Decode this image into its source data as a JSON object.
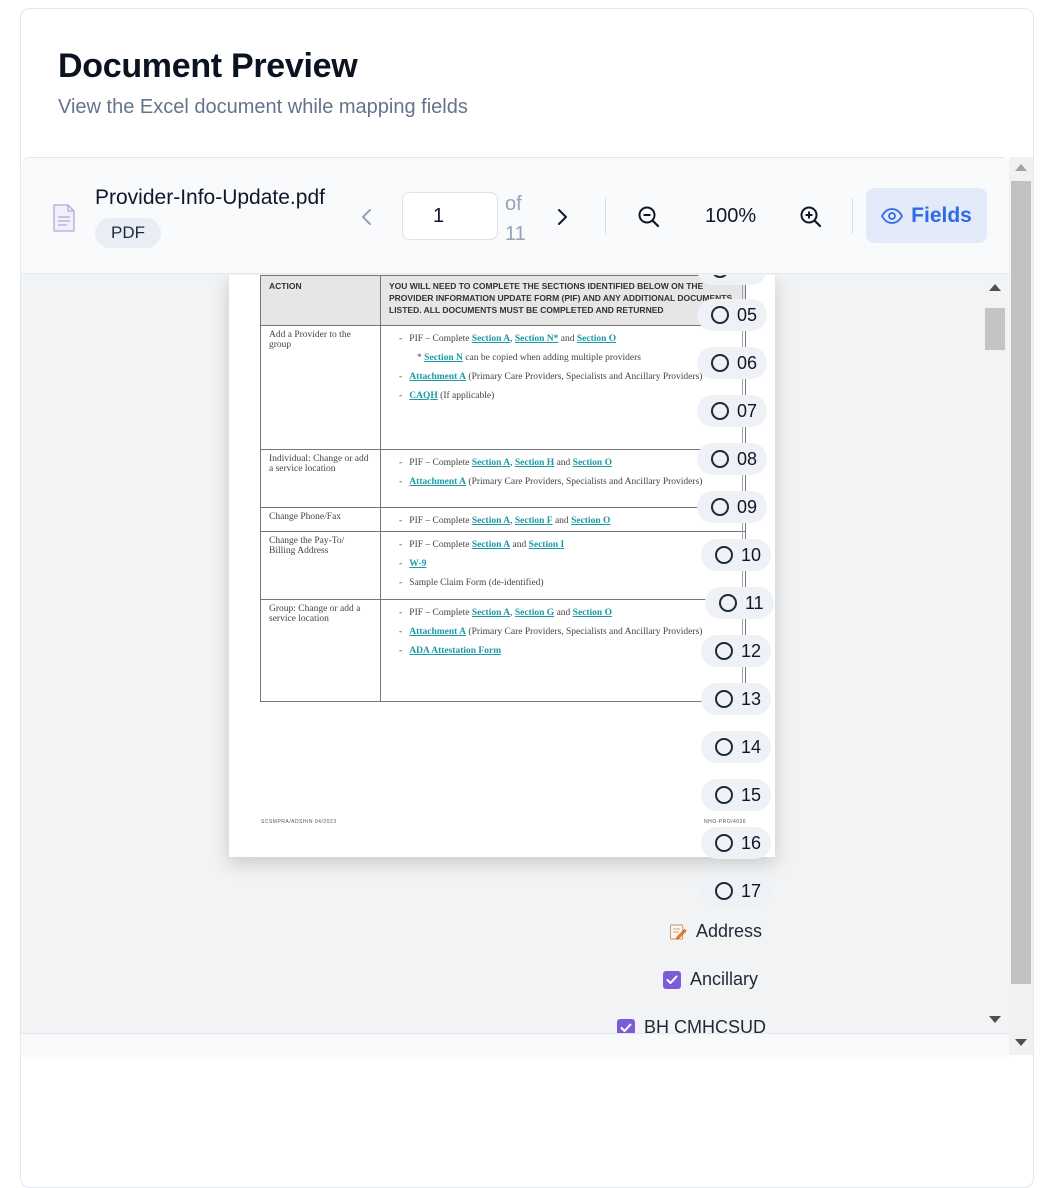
{
  "card": {
    "title": "Document Preview",
    "subtitle": "View the Excel document while mapping fields"
  },
  "toolbar": {
    "file_name": "Provider-Info-Update.pdf",
    "file_type": "PDF",
    "current_page": "1",
    "of_label": "of",
    "total_pages": "11",
    "zoom": "100%",
    "fields_label": "Fields"
  },
  "document": {
    "header_action": "ACTION",
    "header_desc": "YOU WILL NEED TO COMPLETE THE SECTIONS IDENTIFIED BELOW ON THE PROVIDER INFORMATION UPDATE FORM (PIF) AND ANY ADDITIONAL DOCUMENTS LISTED. ALL DOCUMENTS MUST BE COMPLETED AND RETURNED",
    "rows": [
      {
        "action": "Add a Provider to the group"
      },
      {
        "action": "Individual: Change or add a service location"
      },
      {
        "action": "Change Phone/Fax"
      },
      {
        "action": "Change the Pay-To/ Billing Address"
      },
      {
        "action": "Group: Change or add a service location"
      }
    ],
    "footer_left": "SCSMPRA/ADSHIN 04/2023",
    "footer_right": "NHO-PRO/4026"
  },
  "fields": {
    "numbered": [
      "05",
      "06",
      "07",
      "08",
      "09",
      "10",
      "11",
      "12",
      "13",
      "14",
      "15",
      "16",
      "17"
    ],
    "address_label": "Address",
    "ancillary_label": "Ancillary",
    "partial_label": "BH CMHCSUD"
  },
  "colors": {
    "accent": "#2f6be6",
    "accent_bg": "#e3ebfb",
    "checkbox": "#7c5cd6",
    "link": "#1a9aa7"
  }
}
